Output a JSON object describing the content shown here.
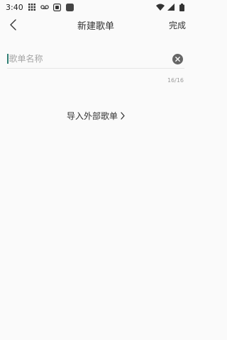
{
  "status_bar": {
    "time": "3:40",
    "icons": [
      "grid-icon",
      "voicemail-icon",
      "square-icon",
      "app-icon",
      "wifi-icon",
      "signal-icon",
      "battery-icon"
    ]
  },
  "header": {
    "title": "新建歌单",
    "done_label": "完成",
    "back_icon": "chevron-left-icon"
  },
  "form": {
    "name_placeholder": "歌单名称",
    "name_value": "",
    "char_count": "16/16",
    "clear_icon": "clear-icon"
  },
  "import": {
    "label": "导入外部歌单",
    "icon": "chevron-right-icon"
  },
  "colors": {
    "background": "#fafafa",
    "caret": "#2f7f74",
    "text": "#333333",
    "placeholder": "#a5a5a5"
  }
}
